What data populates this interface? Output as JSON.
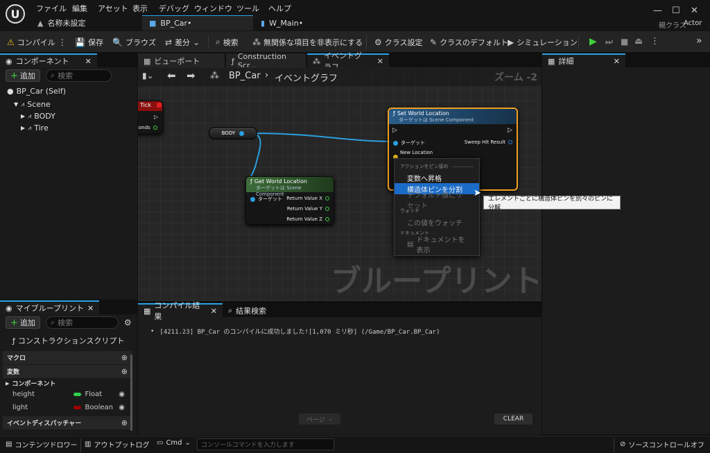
{
  "menu": {
    "items": [
      "ファイル",
      "編集",
      "アセット",
      "表示",
      "デバッグ",
      "ウィンドウ",
      "ツール",
      "ヘルプ"
    ]
  },
  "tabs": [
    {
      "label": "名称未設定"
    },
    {
      "label": "BP_Car•"
    },
    {
      "label": "W_Main•"
    }
  ],
  "parent_class": {
    "label": "親クラス",
    "value": "Actor"
  },
  "toolbar": {
    "compile": "コンパイル",
    "save": "保存",
    "browse": "ブラウズ",
    "diff": "差分",
    "find": "検索",
    "hide_unrelated": "無関係な項目を非表示にする",
    "class_settings": "クラス設定",
    "class_defaults": "クラスのデフォルト",
    "simulation": "シミュレーション"
  },
  "components": {
    "tab": "コンポーネント",
    "add": "追加",
    "search_placeholder": "検索",
    "tree": [
      "BP_Car (Self)",
      "Scene",
      "BODY",
      "Tire"
    ]
  },
  "editor_tabs": {
    "viewport": "ビューポート",
    "construction": "Construction Scr...",
    "event_graph": "イベントグラフ"
  },
  "graph_breadcrumb": {
    "root": "BP_Car",
    "current": "イベントグラフ",
    "zoom": "ズーム -2"
  },
  "graph": {
    "watermark": "ブループリント",
    "tick_node": {
      "title": "Tick",
      "pin": "conds"
    },
    "body_node": {
      "label": "BODY"
    },
    "get_node": {
      "title": "Get World Location",
      "subtitle": "ターゲットは Scene Component",
      "target": "ターゲット",
      "outputs": [
        "Return Value X",
        "Return Value Y",
        "Return Value Z"
      ]
    },
    "set_node": {
      "title": "Set World Location",
      "subtitle": "ターゲットは Scene Component",
      "target": "ターゲット",
      "sweep": "Sweep Hit Result",
      "new_location": "New Location"
    }
  },
  "context_menu": {
    "section_actions": "アクションをピン留め",
    "promote": "変数へ昇格",
    "split": "構造体ピンを分割",
    "reset": "デフォルト値にリセット",
    "section_watch": "ウォッチ",
    "watch": "この値をウォッチ",
    "section_doc": "ドキュメント",
    "doc": "ドキュメントを表示",
    "tooltip": "エレメントごとに構造体ピンを別々のピンに分解"
  },
  "details": {
    "tab": "詳細"
  },
  "my_blueprint": {
    "tab": "マイブループリント",
    "add": "追加",
    "search_placeholder": "検索",
    "construction_script": "コンストラクションスクリプト",
    "macro": "マクロ",
    "variables": "変数",
    "components": "コンポーネント",
    "vars": [
      {
        "name": "height",
        "type": "Float",
        "color": "#2ed14a"
      },
      {
        "name": "light",
        "type": "Boolean",
        "color": "#a40000"
      }
    ],
    "dispatchers": "イベントディスパッチャー"
  },
  "compile_results": {
    "tab": "コンパイル結果",
    "search_tab": "結果検索",
    "message": "[4211.23] BP_Car のコンパイルに成功しました![1,070 ミリ秒] (/Game/BP_Car.BP_Car)",
    "page": "ページ",
    "clear": "CLEAR"
  },
  "statusbar": {
    "content_drawer": "コンテンツドロワー",
    "output_log": "アウトプットログ",
    "cmd": "Cmd",
    "console_placeholder": "コンソールコマンドを入力します",
    "source_control": "ソースコントロールオフ"
  },
  "colors": {
    "accent": "#2aa3e8",
    "node_orange": "#f0a020",
    "exec_green": "#3dd13a"
  }
}
